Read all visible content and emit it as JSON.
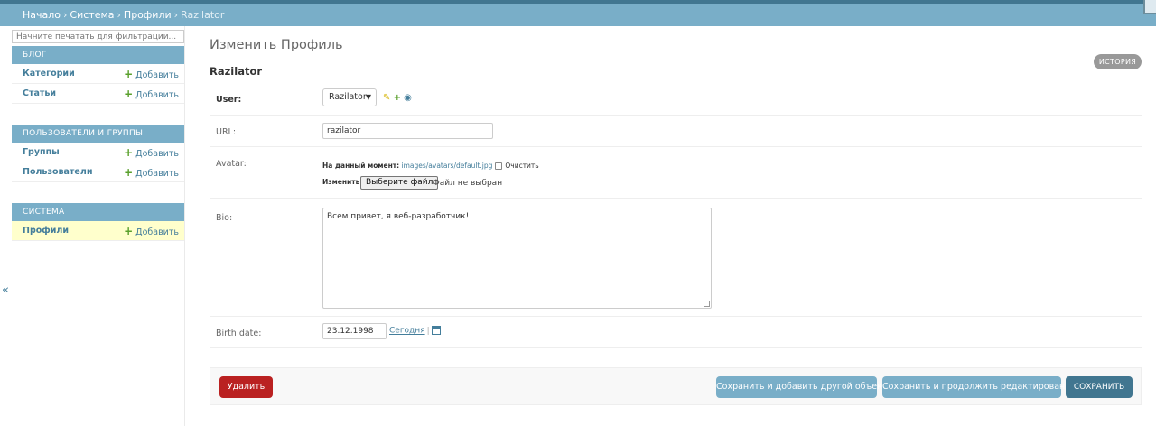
{
  "breadcrumbs": {
    "items": [
      "Начало",
      "Система",
      "Профили"
    ],
    "separator": "›",
    "current": "Razilator"
  },
  "sidebar": {
    "filter_placeholder": "Начните печатать для фильтрации...",
    "add_label": "Добавить",
    "collapse_glyph": "«",
    "modules": [
      {
        "title": "Блог",
        "items": [
          "Категории",
          "Статьи"
        ]
      },
      {
        "title": "Пользователи и группы",
        "items": [
          "Группы",
          "Пользователи"
        ]
      },
      {
        "title": "Система",
        "items": [
          "Профили"
        ]
      }
    ]
  },
  "main": {
    "title": "Изменить Профиль",
    "object_title": "Razilator",
    "history_label": "История"
  },
  "form": {
    "user": {
      "label": "User:",
      "value": "Razilator"
    },
    "url": {
      "label": "URL:",
      "value": "razilator"
    },
    "avatar": {
      "label": "Avatar:",
      "current_label": "На данный момент:",
      "current_value": "images/avatars/default.jpg",
      "clear_label": "Очистить",
      "change_label": "Изменить:",
      "choose_button": "Выберите файл",
      "no_file": "Файл не выбран"
    },
    "bio": {
      "label": "Bio:",
      "value": "Всем привет, я веб-разработчик!"
    },
    "birth_date": {
      "label": "Birth date:",
      "value": "23.12.1998",
      "today_label": "Сегодня",
      "separator": "|"
    }
  },
  "submit": {
    "delete": "Удалить",
    "save_add_another": "Сохранить и добавить другой объект",
    "save_continue": "Сохранить и продолжить редактирование",
    "save": "Сохранить"
  },
  "colors": {
    "header": "#79aec8",
    "header_dark": "#417690",
    "delete": "#ba2121",
    "link": "#447e9b",
    "selected_row": "#ffffcc"
  }
}
